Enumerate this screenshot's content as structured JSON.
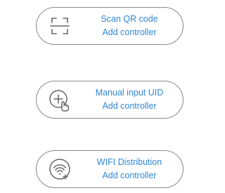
{
  "options": [
    {
      "title": "Scan QR code",
      "subtitle": "Add controller",
      "icon": "scan-qr-icon"
    },
    {
      "title": "Manual input UID",
      "subtitle": "Add controller",
      "icon": "manual-input-icon"
    },
    {
      "title": "WIFI Distribution",
      "subtitle": "Add controller",
      "icon": "wifi-add-icon"
    }
  ],
  "colors": {
    "text": "#2f86d6",
    "border": "#8a8a8a",
    "icon": "#666666",
    "background": "#ffffff"
  }
}
